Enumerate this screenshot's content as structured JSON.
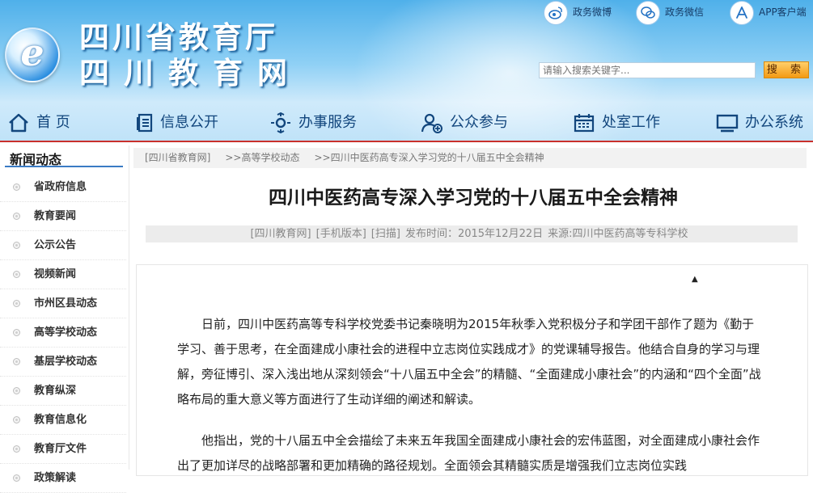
{
  "site": {
    "name_line1": "四川省教育厅",
    "name_line2": "四川教育网",
    "logo_letter": "e"
  },
  "top_links": [
    {
      "label": "政务微博",
      "icon": "weibo-icon"
    },
    {
      "label": "政务微信",
      "icon": "wechat-icon"
    },
    {
      "label": "APP客户端",
      "icon": "app-store-icon"
    }
  ],
  "search": {
    "placeholder": "请输入搜索关键字...",
    "button_label": "搜 索"
  },
  "nav": [
    {
      "label": "首 页",
      "icon": "home-icon"
    },
    {
      "label": "信息公开",
      "icon": "document-list-icon"
    },
    {
      "label": "办事服务",
      "icon": "service-icon"
    },
    {
      "label": "公众参与",
      "icon": "user-add-icon"
    },
    {
      "label": "处室工作",
      "icon": "calendar-icon"
    },
    {
      "label": "办公系统",
      "icon": "monitor-icon"
    }
  ],
  "sidebar": {
    "title": "新闻动态",
    "items": [
      "省政府信息",
      "教育要闻",
      "公示公告",
      "视频新闻",
      "市州区县动态",
      "高等学校动态",
      "基层学校动态",
      "教育纵深",
      "教育信息化",
      "教育厅文件",
      "政策解读"
    ]
  },
  "breadcrumb": [
    "[四川省教育网]",
    ">>高等学校动态",
    ">>四川中医药高专深入学习党的十八届五中全会精神"
  ],
  "article": {
    "title": "四川中医药高专深入学习党的十八届五中全会精神",
    "meta": [
      "[四川教育网]",
      "[手机版本]",
      "[扫描]",
      "发布时间：2015年12月22日",
      "来源:四川中医药高等专科学校"
    ],
    "paragraphs": [
      "日前，四川中医药高等专科学校党委书记秦晓明为2015年秋季入党积极分子和学团干部作了题为《勤于学习、善于思考，在全面建成小康社会的进程中立志岗位实践成才》的党课辅导报告。他结合自身的学习与理解，旁征博引、深入浅出地从深刻领会“十八届五中全会”的精髓、“全面建成小康社会”的内涵和“四个全面”战略布局的重大意义等方面进行了生动详细的阐述和解读。",
      "他指出，党的十八届五中全会描绘了未来五年我国全面建成小康社会的宏伟蓝图，对全面建成小康社会作出了更加详尽的战略部署和更加精确的路径规划。全面领会其精髓实质是增强我们立志岗位实践"
    ]
  },
  "colors": {
    "accent_red": "#c9302c",
    "nav_text": "#12467d",
    "search_button": "#f39a14"
  }
}
